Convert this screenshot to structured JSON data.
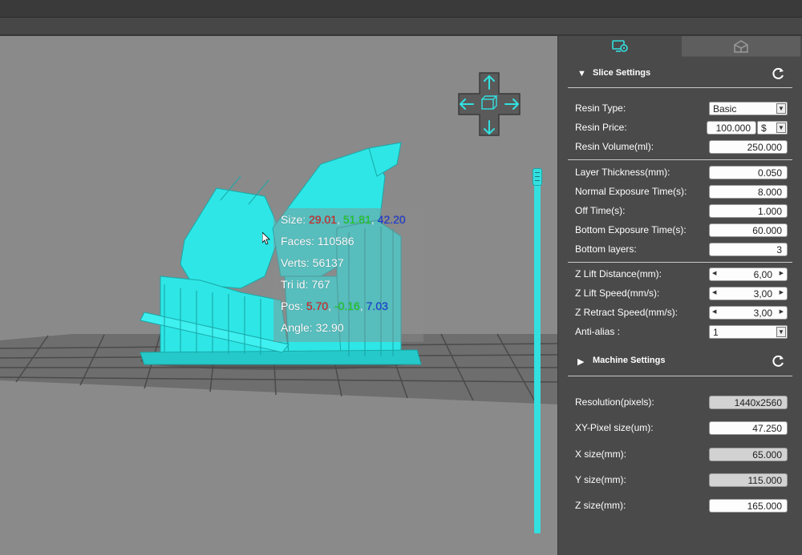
{
  "colors": {
    "accent": "#33e0e0",
    "viewport_bg": "#8a8a8a",
    "panel_bg": "#4a4a4a",
    "size_x": "#e02020",
    "size_y": "#20d020",
    "size_z": "#1a3ae0"
  },
  "tabs": {
    "slice_icon": "monitor-gear-icon",
    "machine_icon": "printer-box-icon"
  },
  "info": {
    "size_label": "Size: ",
    "size_x": "29.01",
    "size_y": "51.81",
    "size_z": "42.20",
    "sep": ", ",
    "faces": "Faces: 110586",
    "verts": "Verts: 56137",
    "tri_id": "Tri id: 767",
    "pos_label": "Pos: ",
    "pos_x": "5.70",
    "pos_y": "-0.16",
    "pos_z": "7.03",
    "angle": "Angle: 32.90"
  },
  "slice_settings": {
    "title": "Slice Settings",
    "resin_type_label": "Resin Type:",
    "resin_type_value": "Basic",
    "resin_price_label": "Resin Price:",
    "resin_price_value": "100.000",
    "resin_currency": "$",
    "resin_volume_label": "Resin Volume(ml):",
    "resin_volume_value": "250.000",
    "layer_thickness_label": "Layer Thickness(mm):",
    "layer_thickness_value": "0.050",
    "normal_exposure_label": "Normal Exposure Time(s):",
    "normal_exposure_value": "8.000",
    "off_time_label": "Off Time(s):",
    "off_time_value": "1.000",
    "bottom_exposure_label": "Bottom Exposure Time(s):",
    "bottom_exposure_value": "60.000",
    "bottom_layers_label": "Bottom layers:",
    "bottom_layers_value": "3",
    "z_lift_distance_label": "Z Lift Distance(mm):",
    "z_lift_distance_value": "6,00",
    "z_lift_speed_label": "Z Lift Speed(mm/s):",
    "z_lift_speed_value": "3,00",
    "z_retract_speed_label": "Z Retract Speed(mm/s):",
    "z_retract_speed_value": "3,00",
    "anti_alias_label": "Anti-alias :",
    "anti_alias_value": "1"
  },
  "machine_settings": {
    "title": "Machine Settings",
    "resolution_label": "Resolution(pixels):",
    "resolution_value": "1440x2560",
    "xy_pixel_label": "XY-Pixel size(um):",
    "xy_pixel_value": "47.250",
    "x_size_label": "X size(mm):",
    "x_size_value": "65.000",
    "y_size_label": "Y size(mm):",
    "y_size_value": "115.000",
    "z_size_label": "Z size(mm):",
    "z_size_value": "165.000"
  }
}
